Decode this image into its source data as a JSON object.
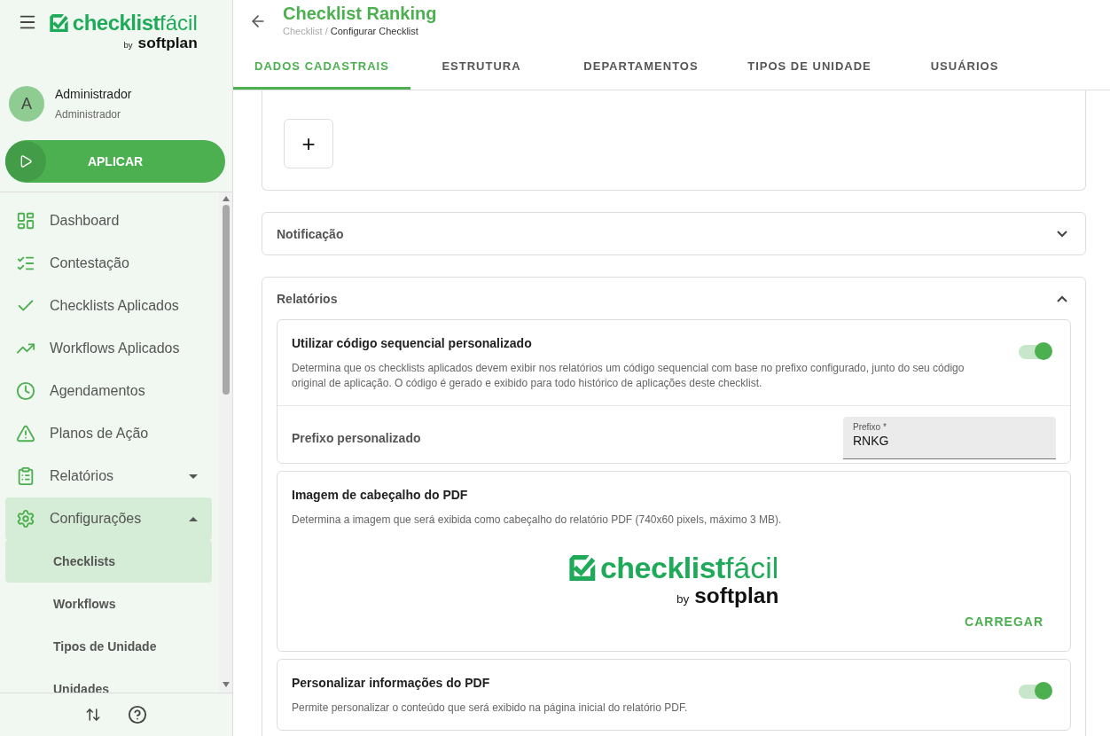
{
  "sidebar": {
    "logo": {
      "brand": "checklist",
      "brand_light": "fácil",
      "by": "by",
      "maker": "softplan"
    },
    "user": {
      "initial": "A",
      "name": "Administrador",
      "role": "Administrador"
    },
    "apply_button": "APLICAR",
    "items": [
      {
        "kind": "dashboard",
        "label": "Dashboard",
        "selected": false
      },
      {
        "kind": "list",
        "label": "Contestação",
        "selected": false
      },
      {
        "kind": "check",
        "label": "Checklists Aplicados",
        "selected": false
      },
      {
        "kind": "trend",
        "label": "Workflows Aplicados",
        "selected": false
      },
      {
        "kind": "clock",
        "label": "Agendamentos",
        "selected": false
      },
      {
        "kind": "warning",
        "label": "Planos de Ação",
        "selected": false
      },
      {
        "kind": "clipboard",
        "label": "Relatórios",
        "selected": false,
        "expanded": false
      },
      {
        "kind": "gear",
        "label": "Configurações",
        "selected": true,
        "expanded": true,
        "children": [
          {
            "label": "Checklists",
            "selected": true
          },
          {
            "label": "Workflows",
            "selected": false
          },
          {
            "label": "Tipos de Unidade",
            "selected": false
          },
          {
            "label": "Unidades",
            "selected": false
          }
        ]
      }
    ]
  },
  "header": {
    "title": "Checklist Ranking",
    "breadcrumb": [
      "Checklist",
      "Configurar Checklist"
    ],
    "breadcrumb_separator": "/"
  },
  "tabs": [
    {
      "label": "DADOS CADASTRAIS",
      "selected": true
    },
    {
      "label": "ESTRUTURA",
      "selected": false
    },
    {
      "label": "DEPARTAMENTOS",
      "selected": false
    },
    {
      "label": "TIPOS DE UNIDADE",
      "selected": false
    },
    {
      "label": "USUÁRIOS",
      "selected": false
    }
  ],
  "attachments": {
    "add_button": "+"
  },
  "sections": [
    {
      "title": "Notificação",
      "expanded": false
    },
    {
      "title": "Relatórios",
      "expanded": true,
      "cards": [
        {
          "kind": "toggle",
          "title": "Utilizar código sequencial personalizado",
          "description": "Determina que os checklists aplicados devem exibir nos relatórios um código sequencial com base no prefixo configurado, junto do seu código original de aplicação. O código é gerado e exibido para todo histórico de aplicações deste checklist.",
          "on": true,
          "field": {
            "label_text": "Prefixo personalizado",
            "label": "Prefixo *",
            "value": "RNKG"
          }
        },
        {
          "kind": "image",
          "title": "Imagem de cabeçalho do PDF",
          "description": "Determina a imagem que será exibida como cabeçalho do relatório PDF (740x60 pixels, máximo 3 MB).",
          "logo": {
            "brand": "checklist",
            "brand_light": "fácil",
            "by": "by",
            "maker": "softplan"
          },
          "action": "CARREGAR"
        },
        {
          "kind": "toggle",
          "title": "Personalizar informações do PDF",
          "description": "Permite personalizar o conteúdo que será exibido na página inicial do relatório PDF.",
          "on": true
        }
      ]
    }
  ]
}
